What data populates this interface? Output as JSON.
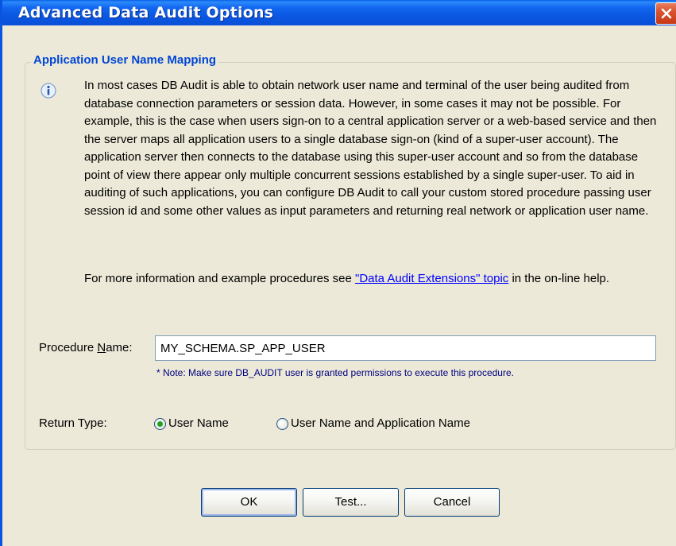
{
  "window": {
    "title": "Advanced Data Audit Options",
    "close_icon": "close-icon",
    "accent_color": "#0A55E0",
    "close_color": "#D9532F"
  },
  "group": {
    "title": "Application User Name Mapping",
    "info_icon": "info-icon",
    "description": "In most cases DB Audit is able to obtain network user name and terminal of the user being audited from database connection parameters or session data.  However, in some cases it may not be possible.  For example, this is the case when users sign-on to a central application server or a web-based service and then the server maps all application users to a single database sign-on (kind of a super-user account).  The application server then connects to the database using this super-user account and so from the database point of view there appear only multiple concurrent sessions established by a single super-user. To aid in auditing of such applications, you can configure DB Audit to call your custom stored procedure passing user session id and some other values as input parameters and returning real network or application user name.",
    "more_info_prefix": "For more information and example procedures see ",
    "more_info_link": "\"Data Audit Extensions\" topic",
    "more_info_suffix": " in the on-line help."
  },
  "procedure": {
    "label_prefix": "Procedure ",
    "label_underlined": "N",
    "label_suffix": "ame:",
    "value": "MY_SCHEMA.SP_APP_USER",
    "note": "* Note: Make sure DB_AUDIT user is granted permissions to execute this procedure."
  },
  "return_type": {
    "label": "Return Type:",
    "options": [
      {
        "label": "User Name",
        "checked": true
      },
      {
        "label": "User Name and Application Name",
        "checked": false
      }
    ]
  },
  "buttons": {
    "ok": "OK",
    "test": "Test...",
    "cancel": "Cancel"
  }
}
